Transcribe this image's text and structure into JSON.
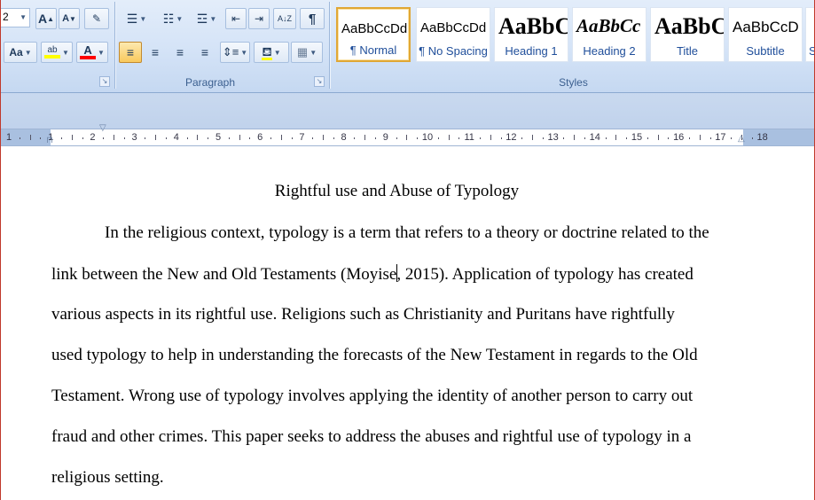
{
  "ribbon": {
    "font": {
      "size_value": "2",
      "grow_label": "A",
      "shrink_label": "A",
      "change_case_label": "Aa",
      "highlight_label": "ab",
      "font_color_label": "A",
      "highlight_color": "#ffff00",
      "font_color": "#ff0000"
    },
    "paragraph": {
      "group_label": "Paragraph",
      "pilcrow": "¶",
      "sort_label": "A↓Z"
    },
    "styles": {
      "group_label": "Styles",
      "items": [
        {
          "sample": "AaBbCcDd",
          "name": "¶ Normal"
        },
        {
          "sample": "AaBbCcDd",
          "name": "¶ No Spacing"
        },
        {
          "sample": "AaBbC",
          "name": "Heading 1"
        },
        {
          "sample": "AaBbCc",
          "name": "Heading 2"
        },
        {
          "sample": "AaBbC",
          "name": "Title"
        },
        {
          "sample": "AaBbCcD",
          "name": "Subtitle"
        },
        {
          "sample": "",
          "name": "S"
        }
      ]
    }
  },
  "ruler": {
    "numbers": [
      "1",
      "1",
      "2",
      "3",
      "4",
      "5",
      "6",
      "7",
      "8",
      "9",
      "10",
      "11",
      "12",
      "13",
      "14",
      "15",
      "16",
      "17",
      "18"
    ]
  },
  "document": {
    "title": "Rightful use and Abuse of Typology",
    "lines": [
      "In the religious context, typology is a term that refers to a theory or doctrine related to the",
      "link between the New and Old Testaments (Moyise",
      ", 2015). Application of typology has created",
      "various aspects in its rightful use. Religions such as Christianity and Puritans have rightfully",
      "used typology to help in understanding the forecasts of the New Testament in regards to the Old",
      "Testament. Wrong use of typology involves applying the identity of another person to carry out",
      "fraud and other crimes. This paper seeks to address the abuses and rightful use of typology in a",
      "religious setting."
    ]
  }
}
